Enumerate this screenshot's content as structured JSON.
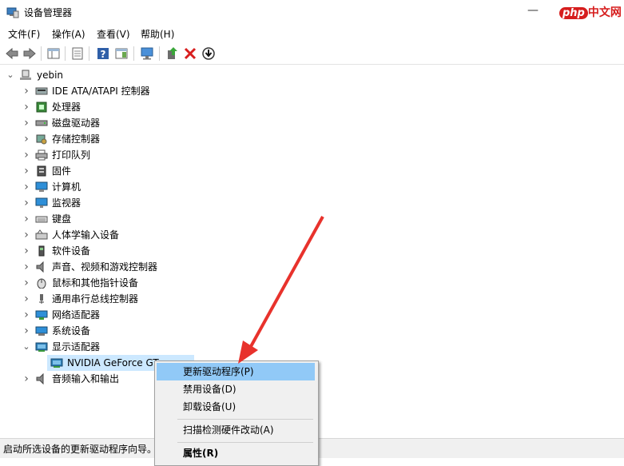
{
  "window": {
    "title": "设备管理器",
    "controls": {
      "minimize": "—",
      "maximize": "☐",
      "close": "✕"
    },
    "watermark_php": "php",
    "watermark_text": "中文网"
  },
  "menubar": [
    "文件(F)",
    "操作(A)",
    "查看(V)",
    "帮助(H)"
  ],
  "toolbar": [
    {
      "icon": "back-arrow-icon"
    },
    {
      "icon": "forward-arrow-icon"
    },
    {
      "icon": "show-hide-console-tree-icon"
    },
    {
      "icon": "properties-icon"
    },
    {
      "icon": "help-icon"
    },
    {
      "icon": "action-pane-icon"
    },
    {
      "icon": "scan-hardware-icon"
    },
    {
      "icon": "update-driver-icon"
    },
    {
      "icon": "uninstall-device-icon"
    },
    {
      "icon": "download-icon"
    }
  ],
  "tree": {
    "root": "yebin",
    "categories": [
      {
        "label": "IDE ATA/ATAPI 控制器",
        "icon": "ide-controller-icon",
        "expanded": false
      },
      {
        "label": "处理器",
        "icon": "processor-icon",
        "expanded": false
      },
      {
        "label": "磁盘驱动器",
        "icon": "disk-drive-icon",
        "expanded": false
      },
      {
        "label": "存储控制器",
        "icon": "storage-controller-icon",
        "expanded": false
      },
      {
        "label": "打印队列",
        "icon": "printer-icon",
        "expanded": false
      },
      {
        "label": "固件",
        "icon": "firmware-icon",
        "expanded": false
      },
      {
        "label": "计算机",
        "icon": "computer-icon",
        "expanded": false
      },
      {
        "label": "监视器",
        "icon": "monitor-icon",
        "expanded": false
      },
      {
        "label": "键盘",
        "icon": "keyboard-icon",
        "expanded": false
      },
      {
        "label": "人体学输入设备",
        "icon": "hid-icon",
        "expanded": false
      },
      {
        "label": "软件设备",
        "icon": "software-device-icon",
        "expanded": false
      },
      {
        "label": "声音、视频和游戏控制器",
        "icon": "sound-icon",
        "expanded": false
      },
      {
        "label": "鼠标和其他指针设备",
        "icon": "mouse-icon",
        "expanded": false
      },
      {
        "label": "通用串行总线控制器",
        "icon": "usb-icon",
        "expanded": false
      },
      {
        "label": "网络适配器",
        "icon": "network-adapter-icon",
        "expanded": false
      },
      {
        "label": "系统设备",
        "icon": "system-device-icon",
        "expanded": false
      },
      {
        "label": "显示适配器",
        "icon": "display-adapter-icon",
        "expanded": true
      },
      {
        "label": "音频输入和输出",
        "icon": "audio-io-icon",
        "expanded": false
      }
    ],
    "selected_child": "NVIDIA GeForce GT"
  },
  "context_menu": {
    "items": [
      "更新驱动程序(P)",
      "禁用设备(D)",
      "卸载设备(U)",
      "扫描检测硬件改动(A)",
      "属性(R)"
    ],
    "highlighted_index": 0
  },
  "status_bar": "启动所选设备的更新驱动程序向导。",
  "colors": {
    "selection": "#cce8ff",
    "menu_highlight": "#91c9f7",
    "arrow": "#e8322c",
    "watermark": "#d61d1d"
  }
}
